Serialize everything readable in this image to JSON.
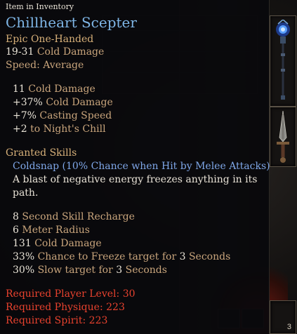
{
  "tooltip": {
    "header": "Item in Inventory",
    "title": "Chillheart Scepter",
    "rarity": "Epic One-Handed",
    "base_damage": {
      "value": "19-31",
      "label": "Cold Damage"
    },
    "speed": {
      "label": "Speed:",
      "value": "Average"
    },
    "stats": [
      {
        "value": "11",
        "label": "Cold Damage"
      },
      {
        "value": "+37%",
        "label": "Cold Damage"
      },
      {
        "value": "+7%",
        "label": "Casting Speed"
      },
      {
        "value": "+2",
        "label": "to Night's Chill"
      }
    ],
    "granted_skills": {
      "heading": "Granted Skills",
      "skill_name": "Coldsnap (10% Chance when Hit by Melee Attacks)",
      "description_line1": "A blast of negative energy freezes anything in its",
      "description_line2": "path.",
      "props": [
        {
          "value": "8",
          "label": "Second Skill Recharge"
        },
        {
          "value": "6",
          "label": "Meter Radius"
        },
        {
          "value": "131",
          "label": "Cold Damage"
        },
        {
          "value": "33%",
          "label": "Chance to Freeze target for",
          "value2": "3",
          "label2": "Seconds"
        },
        {
          "value": "30%",
          "label": "Slow target for",
          "value2": "3",
          "label2": "Seconds"
        }
      ]
    },
    "requirements": [
      {
        "label": "Required Player Level:",
        "value": "30"
      },
      {
        "label": "Required Physique:",
        "value": "223"
      },
      {
        "label": "Required Spirit:",
        "value": "223"
      }
    ]
  },
  "inventory": {
    "slot_bottom_count": "3"
  },
  "colors": {
    "title": "#7fb6e6",
    "stat_label": "#c9a57c",
    "skill": "#7fa7e8",
    "requirement": "#e8422e",
    "section_heading": "#d7b079"
  },
  "icons": [
    "scepter-icon",
    "dagger-icon"
  ]
}
